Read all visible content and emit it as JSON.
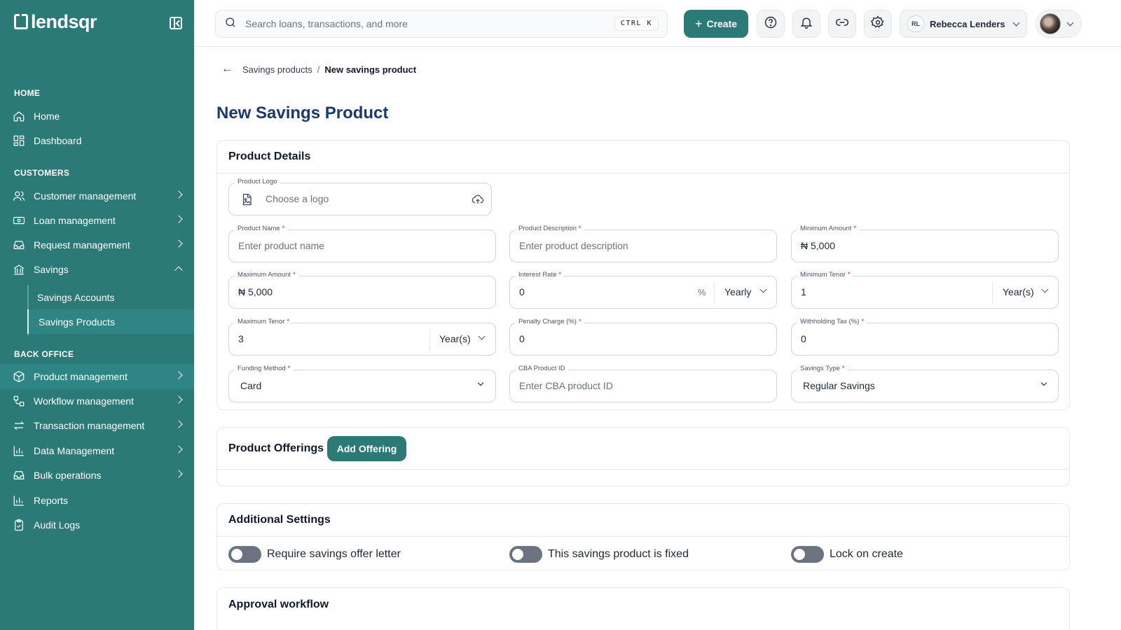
{
  "sidebar": {
    "logo_text": "lendsqr",
    "sections": {
      "home": "HOME",
      "customers": "CUSTOMERS",
      "back_office": "BACK OFFICE"
    },
    "items": {
      "home": "Home",
      "dashboard": "Dashboard",
      "customer_management": "Customer management",
      "loan_management": "Loan management",
      "request_management": "Request management",
      "savings": "Savings",
      "savings_accounts": "Savings Accounts",
      "savings_products": "Savings Products",
      "product_management": "Product management",
      "workflow_management": "Workflow management",
      "transaction_management": "Transaction management",
      "data_management": "Data Management",
      "bulk_operations": "Bulk operations",
      "reports": "Reports",
      "audit_logs": "Audit Logs"
    }
  },
  "topbar": {
    "search_placeholder": "Search loans, transactions, and more",
    "shortcut": "CTRL K",
    "create_label": "Create",
    "user_initials": "RL",
    "user_name": "Rebecca Lenders"
  },
  "breadcrumb": {
    "parent": "Savings products",
    "separator": "/",
    "current": "New savings product"
  },
  "page_title": "New Savings Product",
  "product_details": {
    "heading": "Product Details",
    "logo": {
      "label": "Product Logo",
      "placeholder": "Choose a logo"
    },
    "product_name": {
      "label": "Product Name",
      "placeholder": "Enter product name"
    },
    "product_description": {
      "label": "Product Description",
      "placeholder": "Enter product description"
    },
    "minimum_amount": {
      "label": "Minimum Amount",
      "value": "₦ 5,000"
    },
    "maximum_amount": {
      "label": "Maximum Amount",
      "value": "₦ 5,000"
    },
    "interest_rate": {
      "label": "Interest Rate",
      "value": "0",
      "unit": "%",
      "period": "Yearly"
    },
    "minimum_tenor": {
      "label": "Minimum Tenor",
      "value": "1",
      "unit": "Year(s)"
    },
    "maximum_tenor": {
      "label": "Maximum Tenor",
      "value": "3",
      "unit": "Year(s)"
    },
    "penalty_charge": {
      "label": "Penalty Charge (%)",
      "value": "0"
    },
    "withholding_tax": {
      "label": "Withholding Tax (%)",
      "value": "0"
    },
    "funding_method": {
      "label": "Funding Method",
      "value": "Card"
    },
    "cba_product_id": {
      "label": "CBA Product ID",
      "placeholder": "Enter CBA product ID"
    },
    "savings_type": {
      "label": "Savings Type",
      "value": "Regular Savings"
    },
    "required_mark": "*"
  },
  "product_offerings": {
    "heading": "Product Offerings",
    "add_label": "Add Offering"
  },
  "additional_settings": {
    "heading": "Additional Settings",
    "toggles": {
      "offer_letter": "Require savings offer letter",
      "fixed": "This savings product is fixed",
      "lock": "Lock on create"
    }
  },
  "approval_workflow": {
    "heading": "Approval workflow"
  },
  "colors": {
    "brand": "#2b7a78",
    "title": "#1b3a6b",
    "required": "#dc2626"
  }
}
